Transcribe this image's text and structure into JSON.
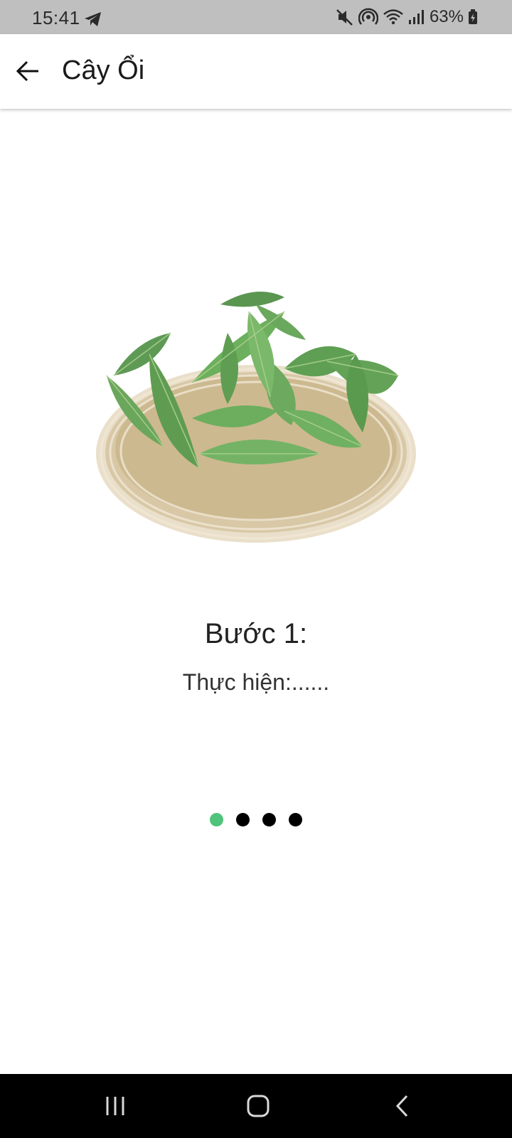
{
  "status_bar": {
    "time": "15:41",
    "battery_percent": "63%",
    "icons": [
      "telegram-icon",
      "mute-icon",
      "hotspot-icon",
      "wifi-icon",
      "signal-icon",
      "battery-icon"
    ]
  },
  "app_bar": {
    "title": "Cây Ổi",
    "back_icon": "arrow-left-icon"
  },
  "step": {
    "title": "Bước 1:",
    "description": "Thực hiện:......"
  },
  "pager": {
    "count": 4,
    "active_index": 0,
    "active_color": "#4fc37a",
    "inactive_color": "#000000"
  },
  "nav_bar": {
    "icons": [
      "recents-icon",
      "home-icon",
      "back-icon"
    ]
  },
  "colors": {
    "status_bar": "#bfbfbf",
    "nav_bar": "#000000",
    "accent": "#4fc37a"
  }
}
